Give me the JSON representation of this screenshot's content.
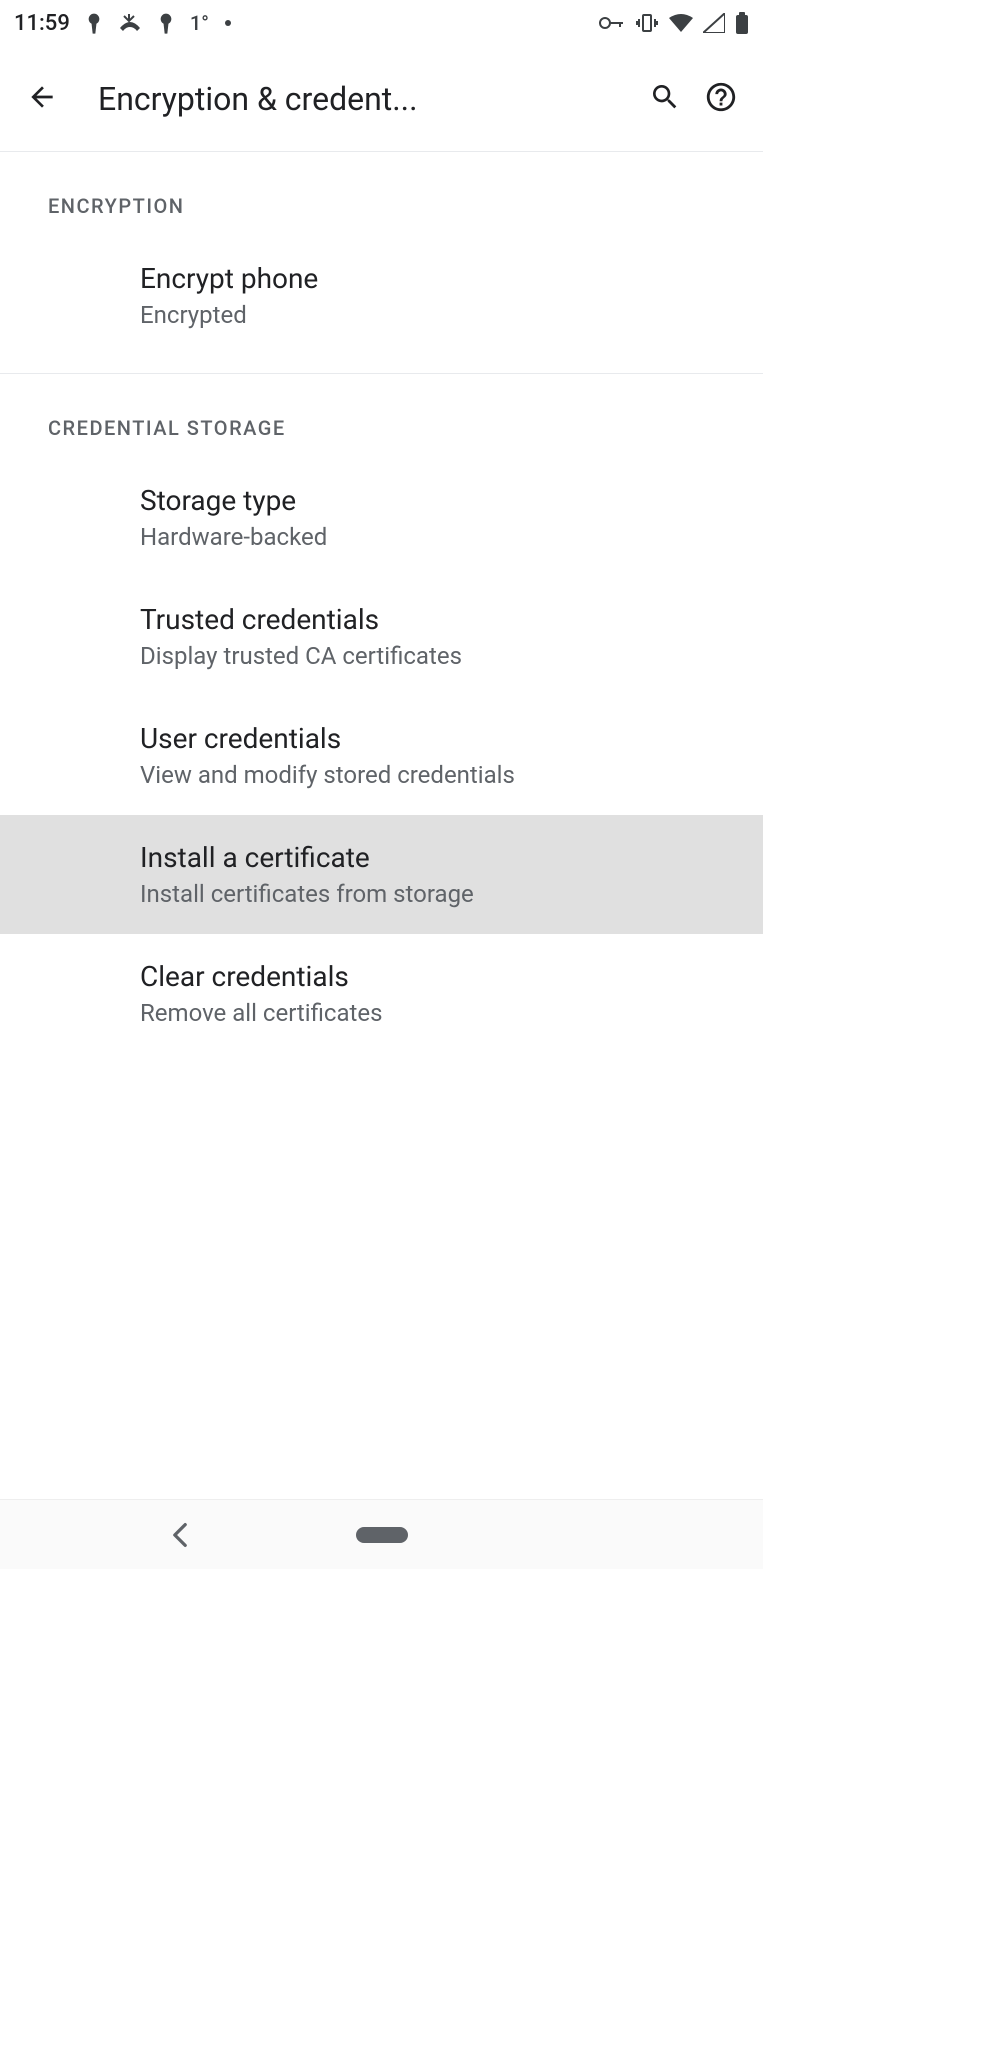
{
  "status": {
    "time": "11:59",
    "notification_temp": "1°"
  },
  "header": {
    "title": "Encryption & credent..."
  },
  "sections": [
    {
      "header": "Encryption",
      "items": [
        {
          "title": "Encrypt phone",
          "subtitle": "Encrypted",
          "highlighted": false
        }
      ]
    },
    {
      "header": "Credential storage",
      "items": [
        {
          "title": "Storage type",
          "subtitle": "Hardware-backed",
          "highlighted": false
        },
        {
          "title": "Trusted credentials",
          "subtitle": "Display trusted CA certificates",
          "highlighted": false
        },
        {
          "title": "User credentials",
          "subtitle": "View and modify stored credentials",
          "highlighted": false
        },
        {
          "title": "Install a certificate",
          "subtitle": "Install certificates from storage",
          "highlighted": true
        },
        {
          "title": "Clear credentials",
          "subtitle": "Remove all certificates",
          "highlighted": false
        }
      ]
    }
  ]
}
